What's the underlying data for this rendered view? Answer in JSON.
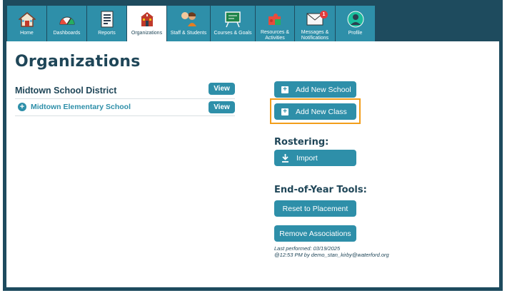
{
  "nav": [
    {
      "label": "Home",
      "icon": "house-icon"
    },
    {
      "label": "Dashboards",
      "icon": "speedometer-icon"
    },
    {
      "label": "Reports",
      "icon": "report-icon"
    },
    {
      "label": "Organizations",
      "icon": "school-building-icon",
      "active": true
    },
    {
      "label": "Staff & Students",
      "icon": "people-icon"
    },
    {
      "label": "Courses & Goals",
      "icon": "chalkboard-icon"
    },
    {
      "label": "Resources & Activities",
      "icon": "puzzle-icon"
    },
    {
      "label": "Messages & Notifications",
      "icon": "envelope-icon",
      "badge": "1"
    },
    {
      "label": "Profile",
      "icon": "profile-icon"
    }
  ],
  "page": {
    "title": "Organizations",
    "district": "Midtown School District",
    "view_label": "View",
    "school": "Midtown Elementary School"
  },
  "actions": {
    "add_school": "Add New School",
    "add_class": "Add New Class",
    "rostering_heading": "Rostering:",
    "import": "Import",
    "eoy_heading": "End-of-Year Tools:",
    "reset": "Reset to Placement",
    "remove": "Remove Associations",
    "last_performed_line1": "Last performed: 03/19/2025",
    "last_performed_line2": "@12:53 PM by demo_stan_kirby@waterford.org"
  },
  "colors": {
    "brand": "#2e8fa9",
    "dark": "#1e4b5e",
    "highlight": "#f29d1a",
    "badge": "#e23b3b"
  }
}
